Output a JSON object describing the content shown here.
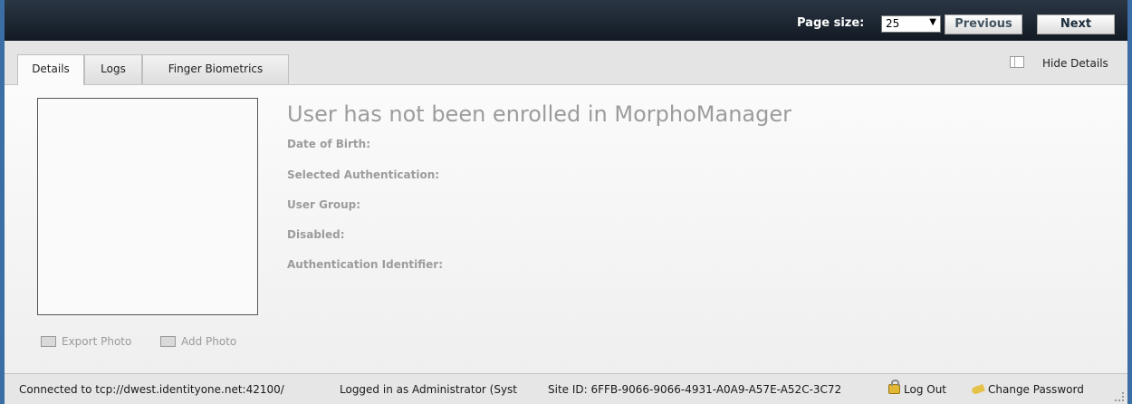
{
  "toolbar": {
    "page_size_label": "Page size:",
    "page_size_value": "25",
    "previous_label": "Previous",
    "next_label": "Next"
  },
  "tabs": [
    {
      "label": "Details",
      "active": true
    },
    {
      "label": "Logs",
      "active": false
    },
    {
      "label": "Finger Biometrics",
      "active": false
    }
  ],
  "hide_details_label": "Hide Details",
  "photo": {
    "export_label": "Export Photo",
    "add_label": "Add Photo"
  },
  "details": {
    "heading": "User has not been enrolled in MorphoManager",
    "fields": [
      "Date of Birth:",
      "Selected Authentication:",
      "User Group:",
      "Disabled:",
      "Authentication Identifier:"
    ]
  },
  "status": {
    "connection": "Connected to tcp://dwest.identityone.net:42100/",
    "logged_in": "Logged in as Administrator (Syst",
    "site_id": "Site ID: 6FFB-9066-9066-4931-A0A9-A57E-A52C-3C72",
    "logout_label": "Log Out",
    "change_password_label": "Change Password"
  },
  "icons": [
    "lock-icon",
    "key-icon",
    "export-photo-icon",
    "add-photo-icon",
    "chevron-down-icon",
    "panel-toggle-icon",
    "resize-grip-icon"
  ]
}
